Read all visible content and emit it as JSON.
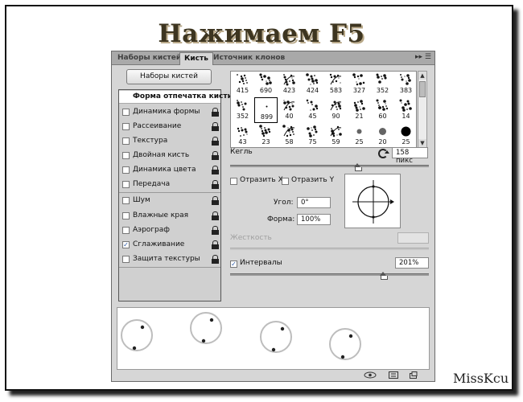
{
  "title": "Нажимаем F5",
  "watermark": "MissKcu",
  "panel": {
    "tabs": [
      "Наборы кистей",
      "Кисть",
      "Источник клонов"
    ],
    "active_tab": 1,
    "presets_button": "Наборы кистей",
    "left_options": [
      {
        "label": "Форма отпечатка кисти",
        "selected": true,
        "checkbox": false,
        "checked": false,
        "lock": false
      },
      {
        "label": "Динамика формы",
        "selected": false,
        "checkbox": true,
        "checked": false,
        "lock": true
      },
      {
        "label": "Рассеивание",
        "selected": false,
        "checkbox": true,
        "checked": false,
        "lock": true
      },
      {
        "label": "Текстура",
        "selected": false,
        "checkbox": true,
        "checked": false,
        "lock": true
      },
      {
        "label": "Двойная кисть",
        "selected": false,
        "checkbox": true,
        "checked": false,
        "lock": true
      },
      {
        "label": "Динамика цвета",
        "selected": false,
        "checkbox": true,
        "checked": false,
        "lock": true
      },
      {
        "label": "Передача",
        "selected": false,
        "checkbox": true,
        "checked": false,
        "lock": true
      },
      {
        "label": "Шум",
        "selected": false,
        "checkbox": true,
        "checked": false,
        "lock": true
      },
      {
        "label": "Влажные края",
        "selected": false,
        "checkbox": true,
        "checked": false,
        "lock": true
      },
      {
        "label": "Аэрограф",
        "selected": false,
        "checkbox": true,
        "checked": false,
        "lock": true
      },
      {
        "label": "Сглаживание",
        "selected": false,
        "checkbox": true,
        "checked": true,
        "lock": true
      },
      {
        "label": "Защита текстуры",
        "selected": false,
        "checkbox": true,
        "checked": false,
        "lock": true
      }
    ],
    "brush_sizes": [
      [
        "415",
        "690",
        "423",
        "424",
        "583",
        "327",
        "352",
        "383"
      ],
      [
        "352",
        "899",
        "40",
        "45",
        "90",
        "21",
        "60",
        "14"
      ],
      [
        "43",
        "23",
        "58",
        "75",
        "59",
        "25",
        "20",
        "25"
      ]
    ],
    "selected_brush": [
      1,
      1
    ],
    "size_label": "Кегль",
    "size_value": "158 пикс",
    "size_level": 0.64,
    "flip_x_label": "Отразить X",
    "flip_y_label": "Отразить Y",
    "flip_x": false,
    "flip_y": false,
    "angle_label": "Угол:",
    "angle_value": "0°",
    "roundness_label": "Форма:",
    "roundness_value": "100%",
    "hardness_label": "Жесткость",
    "hardness_value": "",
    "spacing_label": "Интервалы",
    "spacing_checked": true,
    "spacing_value": "201%",
    "spacing_level": 0.77
  }
}
